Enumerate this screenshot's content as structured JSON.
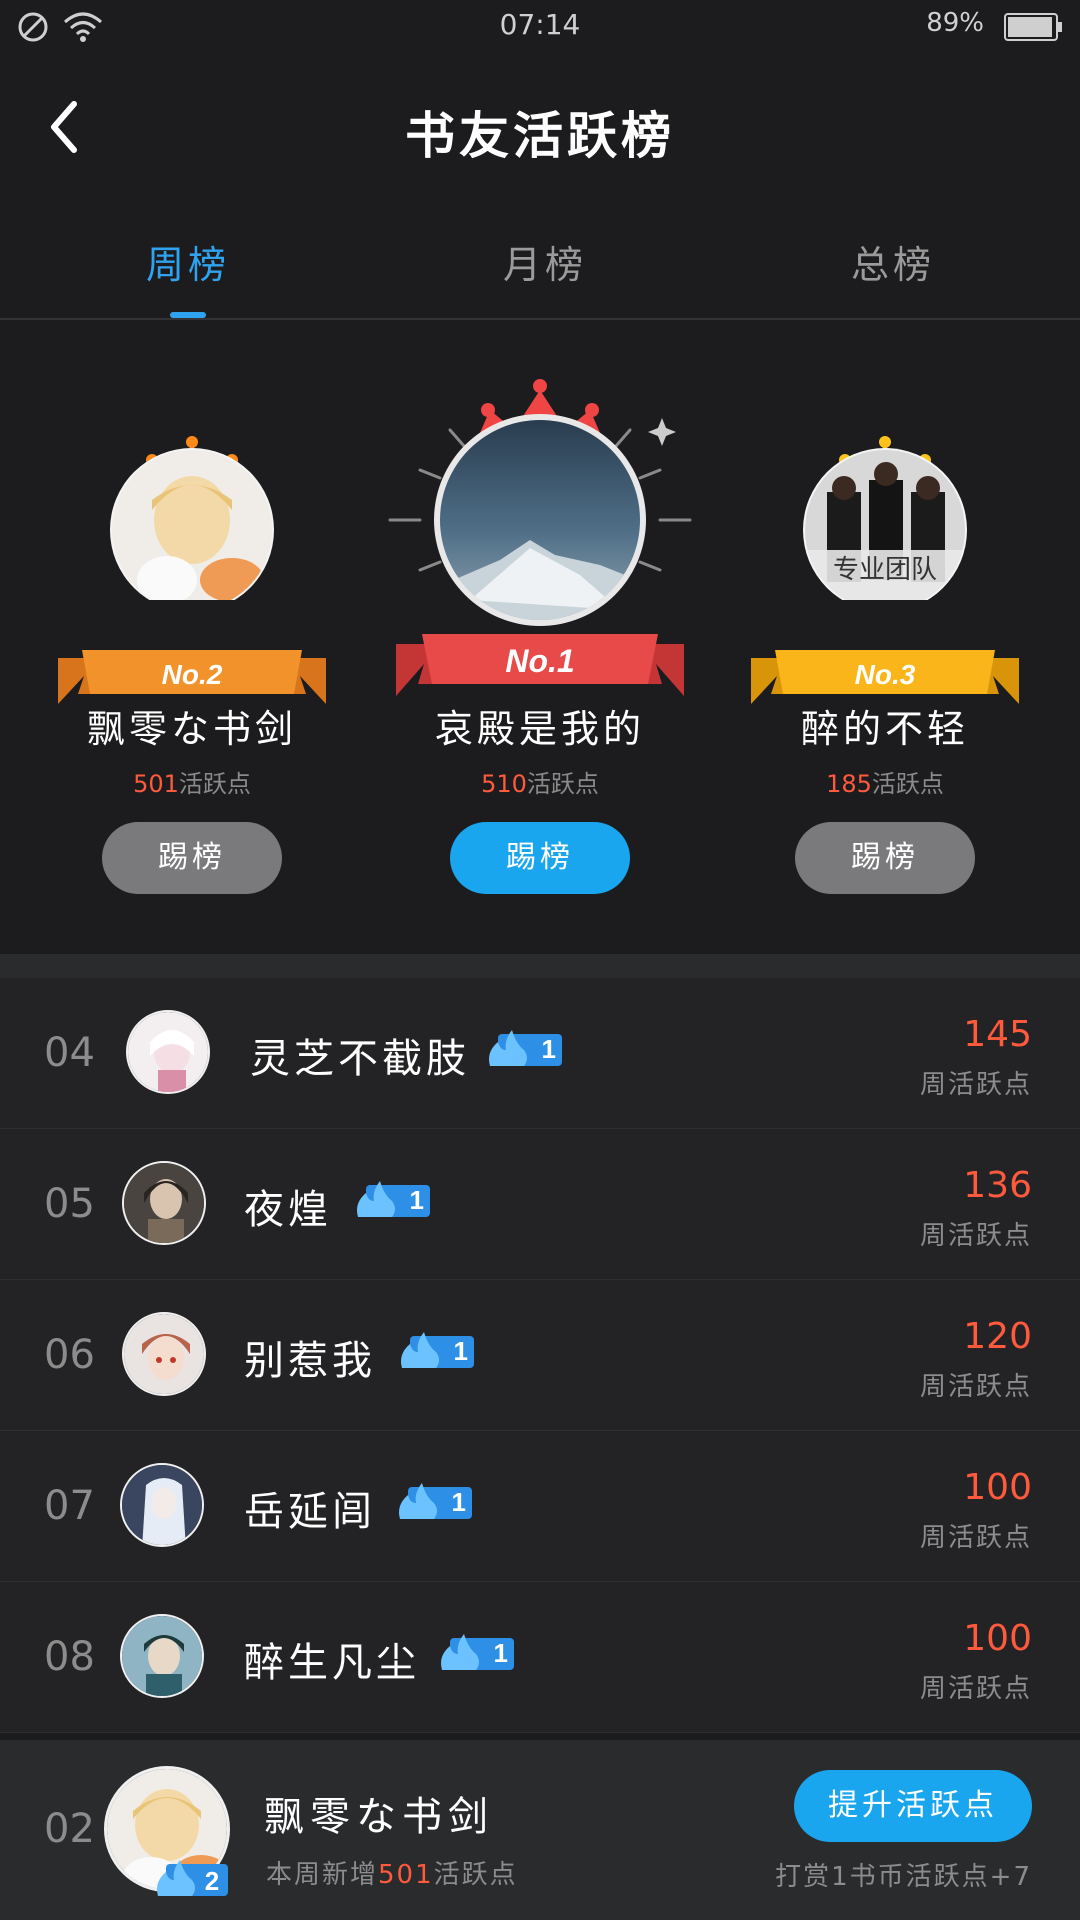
{
  "status": {
    "time": "07:14",
    "battery": "89%",
    "icons": [
      "do-not-disturb-icon",
      "wifi-icon",
      "battery-icon"
    ]
  },
  "header": {
    "title": "书友活跃榜",
    "back_icon": "chevron-left-icon"
  },
  "tabs": [
    {
      "label": "周榜",
      "active": true
    },
    {
      "label": "月榜",
      "active": false
    },
    {
      "label": "总榜",
      "active": false
    }
  ],
  "podium": [
    {
      "rank_label": "No.2",
      "name": "飘零な书剑",
      "points": "501",
      "points_unit": "活跃点",
      "button": "踢榜",
      "crown_color": "#ff8a1a",
      "ribbon_color": "#f2922b"
    },
    {
      "rank_label": "No.1",
      "name": "哀殿是我的",
      "points": "510",
      "points_unit": "活跃点",
      "button": "踢榜",
      "crown_color": "#f04545",
      "ribbon_color": "#e84a4a"
    },
    {
      "rank_label": "No.3",
      "name": "醉的不轻",
      "points": "185",
      "points_unit": "活跃点",
      "button": "踢榜",
      "crown_color": "#ffc21a",
      "ribbon_color": "#f9b51a",
      "avatar_text": "专业团队"
    }
  ],
  "list": [
    {
      "rank": "04",
      "name": "灵芝不截肢",
      "badge": "1",
      "score": "145",
      "score_label": "周活跃点"
    },
    {
      "rank": "05",
      "name": "夜煌",
      "badge": "1",
      "score": "136",
      "score_label": "周活跃点"
    },
    {
      "rank": "06",
      "name": "别惹我",
      "badge": "1",
      "score": "120",
      "score_label": "周活跃点"
    },
    {
      "rank": "07",
      "name": "岳延闾",
      "badge": "1",
      "score": "100",
      "score_label": "周活跃点"
    },
    {
      "rank": "08",
      "name": "醉生凡尘",
      "badge": "1",
      "score": "100",
      "score_label": "周活跃点"
    }
  ],
  "footer": {
    "rank": "02",
    "name": "飘零な书剑",
    "badge": "2",
    "sub_prefix": "本周新增",
    "sub_num": "501",
    "sub_suffix": "活跃点",
    "button": "提升活跃点",
    "tip": "打赏1书币活跃点+7"
  },
  "colors": {
    "accent": "#1aa6ee",
    "points": "#ff5a3c",
    "tab_active": "#2fa3f0"
  }
}
